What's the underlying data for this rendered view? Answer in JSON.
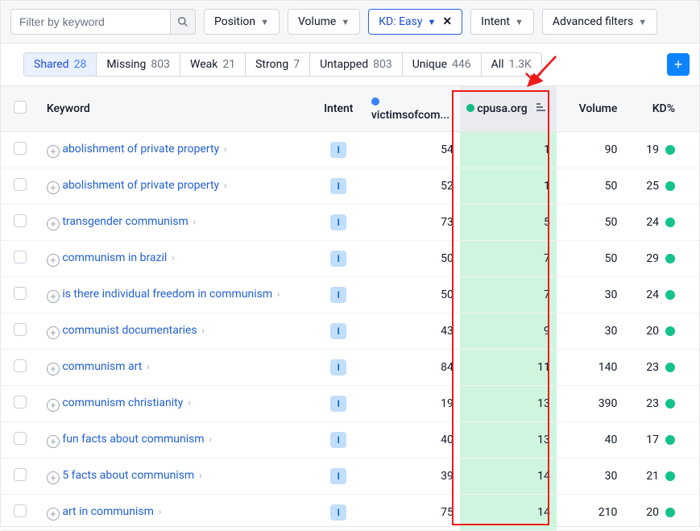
{
  "filters": {
    "search_placeholder": "Filter by keyword",
    "position": "Position",
    "volume": "Volume",
    "kd": "KD: Easy",
    "intent": "Intent",
    "advanced": "Advanced filters"
  },
  "tabs": {
    "shared": {
      "label": "Shared",
      "count": "28"
    },
    "missing": {
      "label": "Missing",
      "count": "803"
    },
    "weak": {
      "label": "Weak",
      "count": "21"
    },
    "strong": {
      "label": "Strong",
      "count": "7"
    },
    "untapped": {
      "label": "Untapped",
      "count": "803"
    },
    "unique": {
      "label": "Unique",
      "count": "446"
    },
    "all": {
      "label": "All",
      "count": "1.3K"
    }
  },
  "headers": {
    "keyword": "Keyword",
    "intent": "Intent",
    "domain1": "victimsofcom...",
    "domain2": "cpusa.org",
    "volume": "Volume",
    "kd": "KD%"
  },
  "intent_letter": "I",
  "rows": [
    {
      "kw": "abolishment of private property",
      "d1": "54",
      "d2": "1",
      "vol": "90",
      "kd": "19"
    },
    {
      "kw": "abolishment of private property",
      "d1": "52",
      "d2": "1",
      "vol": "50",
      "kd": "25"
    },
    {
      "kw": "transgender communism",
      "d1": "73",
      "d2": "5",
      "vol": "50",
      "kd": "24"
    },
    {
      "kw": "communism in brazil",
      "d1": "50",
      "d2": "7",
      "vol": "50",
      "kd": "29"
    },
    {
      "kw": "is there individual freedom in communism",
      "d1": "50",
      "d2": "7",
      "vol": "30",
      "kd": "24"
    },
    {
      "kw": "communist documentaries",
      "d1": "43",
      "d2": "9",
      "vol": "30",
      "kd": "20"
    },
    {
      "kw": "communism art",
      "d1": "84",
      "d2": "11",
      "vol": "140",
      "kd": "23"
    },
    {
      "kw": "communism christianity",
      "d1": "19",
      "d2": "13",
      "vol": "390",
      "kd": "23"
    },
    {
      "kw": "fun facts about communism",
      "d1": "40",
      "d2": "13",
      "vol": "40",
      "kd": "17"
    },
    {
      "kw": "5 facts about communism",
      "d1": "39",
      "d2": "14",
      "vol": "30",
      "kd": "21"
    },
    {
      "kw": "art in communism",
      "d1": "75",
      "d2": "14",
      "vol": "210",
      "kd": "20"
    }
  ]
}
